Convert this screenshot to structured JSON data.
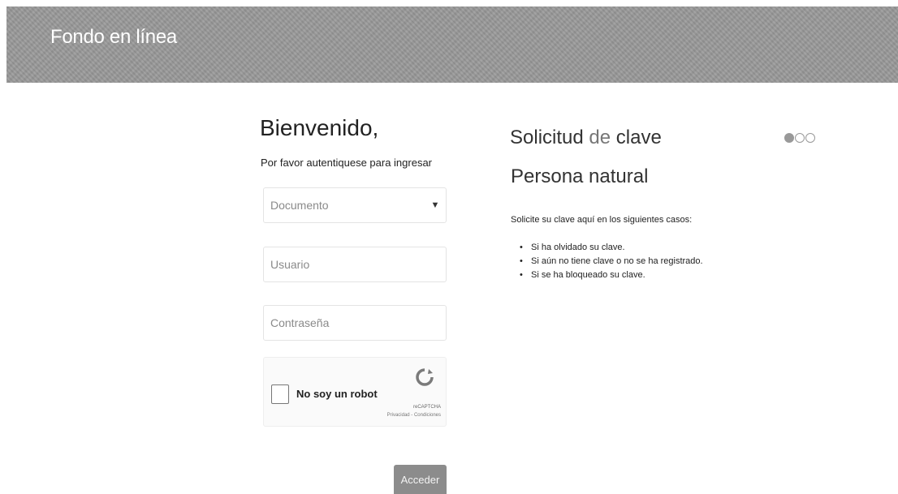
{
  "header": {
    "title": "Fondo en línea"
  },
  "login": {
    "title": "Bienvenido,",
    "subtitle": "Por favor autentiquese para ingresar",
    "document_select": {
      "value": "Documento"
    },
    "user_field": {
      "placeholder": "Usuario"
    },
    "password_field": {
      "placeholder": "Contraseña"
    },
    "captcha": {
      "label": "No soy un robot",
      "brand": "reCAPTCHA",
      "terms": "Privacidad - Condiciones"
    },
    "submit_label": "Acceder"
  },
  "request": {
    "title_start": "Solicitud",
    "title_highlight": "de",
    "title_end": "clave",
    "subtitle": "Persona natural",
    "intro": "Solicite su clave aquí en los siguientes casos:",
    "cases": [
      "Si ha olvidado su clave.",
      "Si aún no tiene clave o no se ha registrado.",
      "Si se ha bloqueado su clave."
    ],
    "carousel": {
      "count": 3,
      "active": 1
    }
  },
  "colors": {
    "banner": "#9a9a9a",
    "button": "#8c8c8c",
    "text": "#222222"
  }
}
